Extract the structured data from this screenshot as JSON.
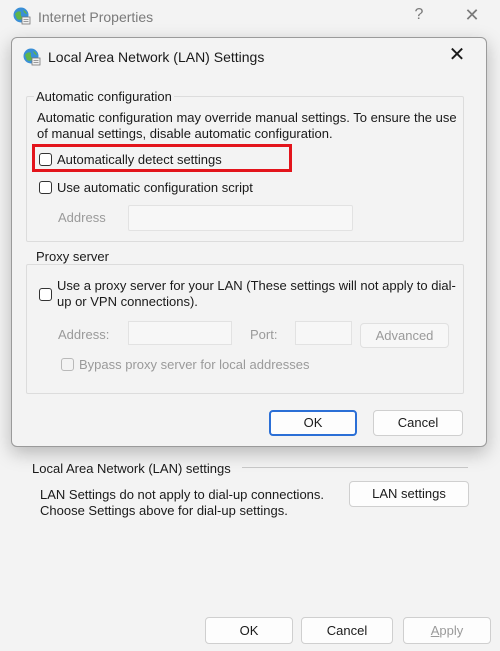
{
  "parent_window": {
    "title": "Internet Properties",
    "help_glyph": "?",
    "close_glyph": "✕",
    "lan_group_label": "Local Area Network (LAN) settings",
    "lan_description": "LAN Settings do not apply to dial-up connections.\nChoose Settings above for dial-up settings.",
    "lan_settings_button": "LAN settings",
    "ok_button": "OK",
    "cancel_button": "Cancel",
    "apply_button": "Apply"
  },
  "dialog": {
    "title": "Local Area Network (LAN) Settings",
    "close_glyph": "✕",
    "automatic_configuration": {
      "group_label": "Automatic configuration",
      "description": "Automatic configuration may override manual settings.  To ensure the use of manual settings, disable automatic configuration.",
      "auto_detect_label": "Automatically detect settings",
      "auto_detect_checked": false,
      "auto_script_label": "Use automatic configuration script",
      "auto_script_checked": false,
      "address_label": "Address",
      "address_value": ""
    },
    "proxy_server": {
      "group_label": "Proxy server",
      "use_proxy_label": "Use a proxy server for your LAN (These settings will not apply to dial-up or VPN connections).",
      "use_proxy_checked": false,
      "address_label": "Address:",
      "address_value": "",
      "port_label": "Port:",
      "port_value": "",
      "advanced_button": "Advanced",
      "bypass_label": "Bypass proxy server for local addresses",
      "bypass_checked": false
    },
    "ok_button": "OK",
    "cancel_button": "Cancel"
  },
  "colors": {
    "highlight_border": "#e3141b",
    "default_button_border": "#2b6fd6"
  },
  "icons": {
    "window_icon": "internet-options-icon",
    "dialog_icon": "lan-settings-icon"
  }
}
